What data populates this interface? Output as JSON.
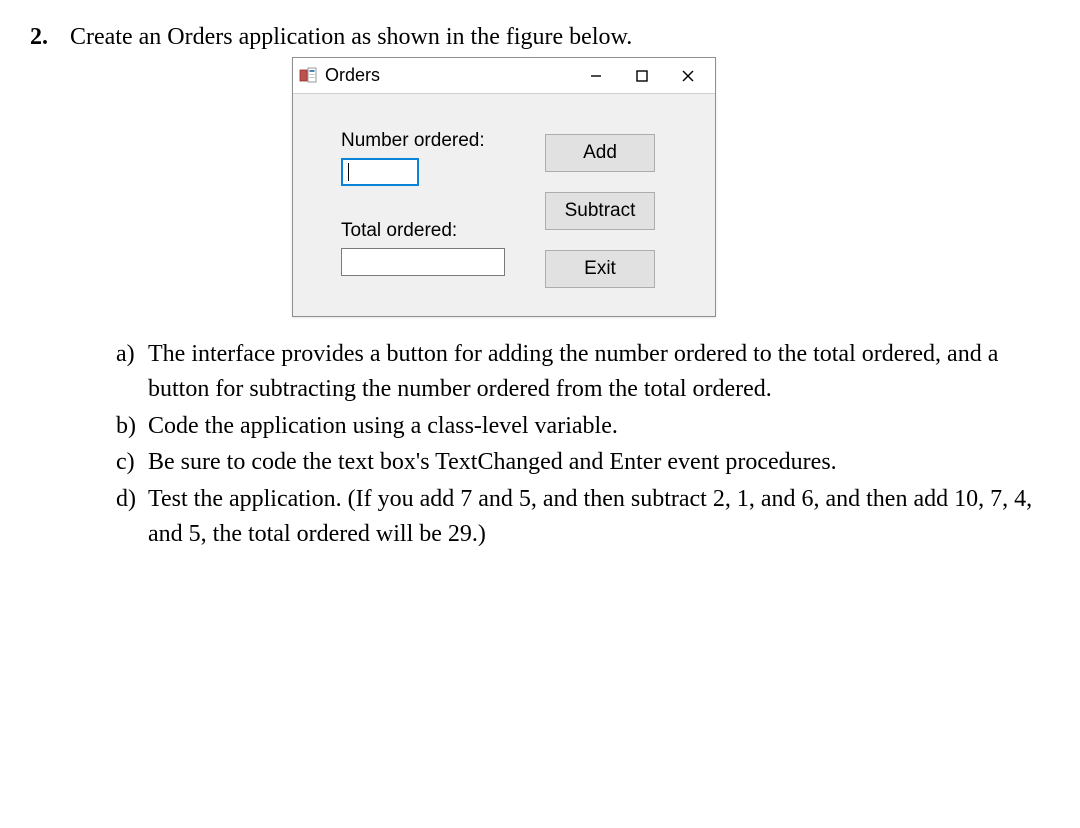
{
  "question": {
    "number": "2.",
    "intro": "Create an Orders application as shown in the figure below."
  },
  "window": {
    "title": "Orders",
    "labels": {
      "number_ordered": "Number ordered:",
      "total_ordered": "Total ordered:"
    },
    "inputs": {
      "number_value": "",
      "total_value": ""
    },
    "buttons": {
      "add": "Add",
      "subtract": "Subtract",
      "exit": "Exit"
    }
  },
  "subitems": {
    "a": {
      "letter": "a)",
      "text": "The interface provides a button for adding the number ordered to the total ordered, and a button for subtracting the number ordered from the total ordered."
    },
    "b": {
      "letter": "b)",
      "text": "Code the application using a class-level variable."
    },
    "c": {
      "letter": "c)",
      "text": "Be sure to code the text box's TextChanged and Enter event procedures."
    },
    "d": {
      "letter": "d)",
      "text": "Test the application. (If you add 7 and 5, and then subtract 2, 1, and 6, and then add 10, 7, 4, and 5, the total ordered will be 29.)"
    }
  }
}
